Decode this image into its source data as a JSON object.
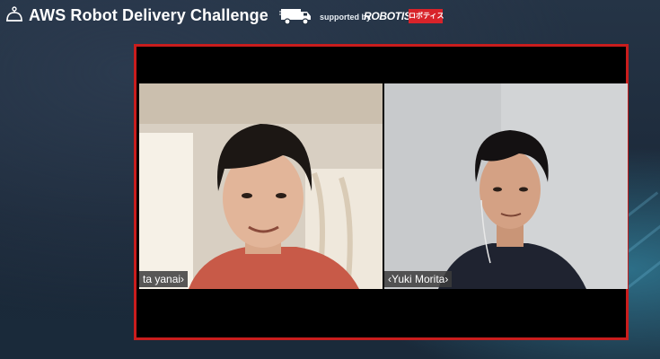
{
  "header": {
    "title": "AWS Robot Delivery Challenge",
    "supported_by": "supported by",
    "sponsor": "ROBOTIS",
    "sponsor_badge": "ロボティス"
  },
  "participants": [
    {
      "name": "ta yanai›"
    },
    {
      "name": "‹Yuki Morita›"
    }
  ],
  "colors": {
    "frame_border": "#c91d1d",
    "sponsor_badge": "#d8232a",
    "background": "#1b2838"
  },
  "icons": {
    "logo": "robot-dome-icon",
    "truck": "delivery-truck-icon"
  }
}
